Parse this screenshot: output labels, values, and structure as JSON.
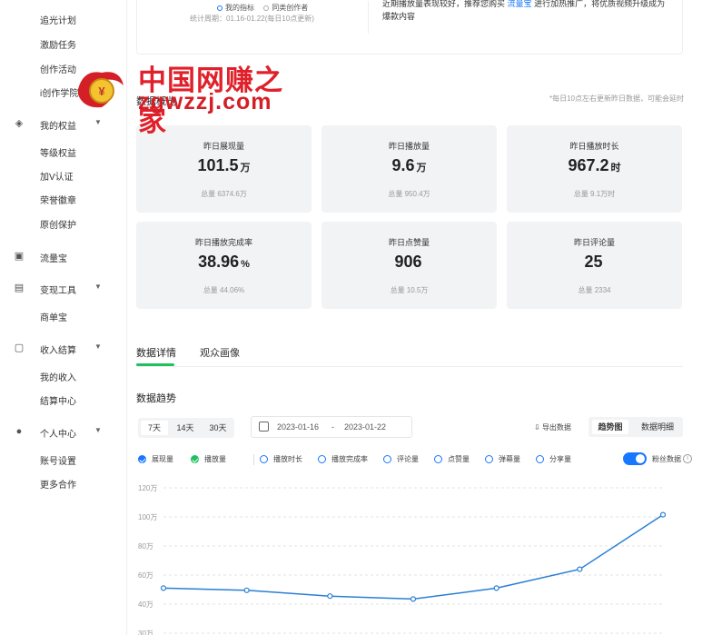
{
  "sidebar": {
    "top_items": [
      "追光计划",
      "激励任务",
      "创作活动",
      "i创作学院"
    ],
    "groups": [
      {
        "icon": "diamond-icon",
        "label": "我的权益",
        "expanded": true,
        "items": [
          "等级权益",
          "加V认证",
          "荣誉徽章",
          "原创保护"
        ]
      },
      {
        "icon": "flow-icon",
        "label": "流量宝",
        "expanded": false,
        "items": []
      },
      {
        "icon": "monetize-icon",
        "label": "变现工具",
        "expanded": true,
        "items": [
          "商单宝"
        ]
      },
      {
        "icon": "wallet-icon",
        "label": "收入结算",
        "expanded": true,
        "items": [
          "我的收入",
          "结算中心"
        ]
      },
      {
        "icon": "user-icon",
        "label": "个人中心",
        "expanded": true,
        "items": [
          "账号设置",
          "更多合作"
        ]
      }
    ]
  },
  "top_card": {
    "radio_options": [
      "我的指标",
      "同类创作者"
    ],
    "stat_period": "统计周期：01.16-01.22(每日10点更新)",
    "tip_prefix": "近期播放量表现较好，推荐您购买",
    "tip_link": "流量宝",
    "tip_suffix": "进行加热推广，将优质视频升级成为爆款内容"
  },
  "watermark": {
    "line1": "中国网赚之家",
    "line2": "zgwzzj.com"
  },
  "overview": {
    "title": "数据概览",
    "update_note": "*每日10点左右更新昨日数据，可能会延时",
    "metrics": [
      {
        "label": "昨日展现量",
        "value": "101.5",
        "unit": "万",
        "total": "总量 6374.6万"
      },
      {
        "label": "昨日播放量",
        "value": "9.6",
        "unit": "万",
        "total": "总量 950.4万"
      },
      {
        "label": "昨日播放时长",
        "value": "967.2",
        "unit": "时",
        "total": "总量 9.1万时"
      },
      {
        "label": "昨日播放完成率",
        "value": "38.96",
        "unit": "%",
        "total": "总量 44.06%"
      },
      {
        "label": "昨日点赞量",
        "value": "906",
        "unit": "",
        "total": "总量 10.5万"
      },
      {
        "label": "昨日评论量",
        "value": "25",
        "unit": "",
        "total": "总量 2334"
      }
    ]
  },
  "tabs": [
    "数据详情",
    "观众画像"
  ],
  "trend": {
    "title": "数据趋势",
    "ranges": [
      "7天",
      "14天",
      "30天"
    ],
    "date_start": "2023-01-16",
    "date_sep": "-",
    "date_end": "2023-01-22",
    "export_label": "导出数据",
    "views": [
      "趋势图",
      "数据明细"
    ],
    "checkboxes": [
      {
        "label": "展现量",
        "state": "on-blue"
      },
      {
        "label": "播放量",
        "state": "on-green"
      },
      {
        "label": "播放时长",
        "state": "off"
      },
      {
        "label": "播放完成率",
        "state": "off"
      },
      {
        "label": "评论量",
        "state": "off"
      },
      {
        "label": "点赞量",
        "state": "off"
      },
      {
        "label": "弹幕量",
        "state": "off"
      },
      {
        "label": "分享量",
        "state": "off"
      }
    ],
    "fans_label": "粉丝数据",
    "fans_toggle_on": true
  },
  "chart_data": {
    "type": "line",
    "y_ticks": [
      "120万",
      "100万",
      "80万",
      "60万",
      "40万",
      "30万"
    ],
    "ylim": [
      30,
      120
    ],
    "series": [
      {
        "values": [
          51,
          49.5,
          45.5,
          43.5,
          51,
          64,
          101.5
        ],
        "color": "#2a7fd4"
      }
    ],
    "grid": true
  }
}
